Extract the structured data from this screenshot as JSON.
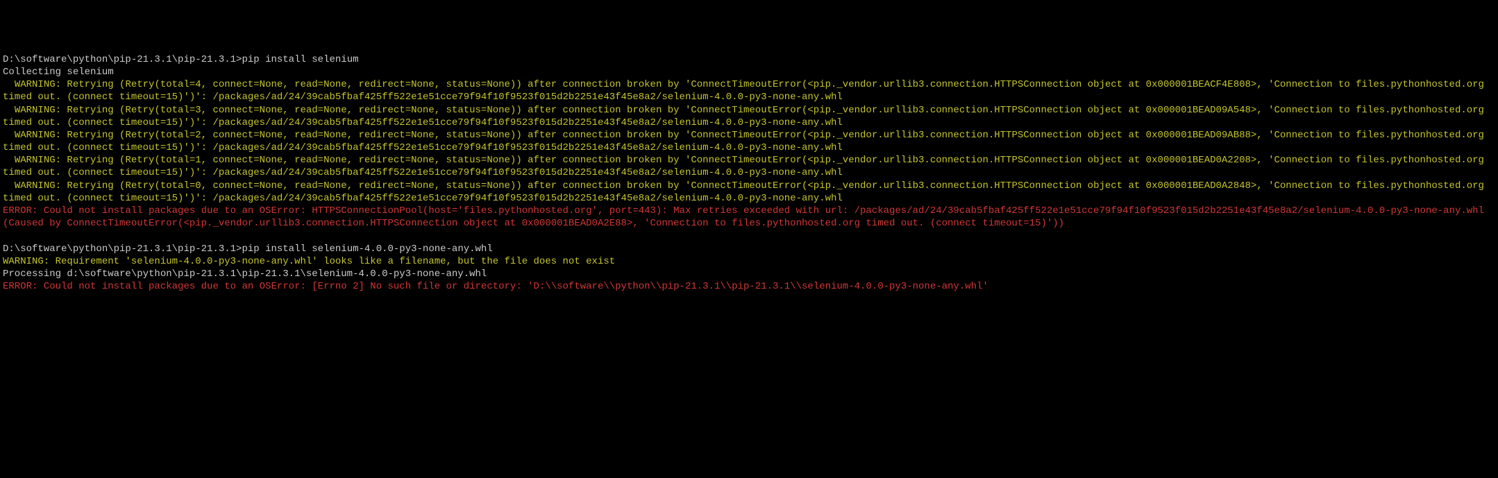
{
  "terminal": {
    "prompt1": {
      "path": "D:\\software\\python\\pip-21.3.1\\pip-21.3.1>",
      "command": "pip install selenium"
    },
    "collecting": "Collecting selenium",
    "warning1": "  WARNING: Retrying (Retry(total=4, connect=None, read=None, redirect=None, status=None)) after connection broken by 'ConnectTimeoutError(<pip._vendor.urllib3.connection.HTTPSConnection object at 0x000001BEACF4E808>, 'Connection to files.pythonhosted.org timed out. (connect timeout=15)')': /packages/ad/24/39cab5fbaf425ff522e1e51cce79f94f10f9523f015d2b2251e43f45e8a2/selenium-4.0.0-py3-none-any.whl",
    "warning2": "  WARNING: Retrying (Retry(total=3, connect=None, read=None, redirect=None, status=None)) after connection broken by 'ConnectTimeoutError(<pip._vendor.urllib3.connection.HTTPSConnection object at 0x000001BEAD09A548>, 'Connection to files.pythonhosted.org timed out. (connect timeout=15)')': /packages/ad/24/39cab5fbaf425ff522e1e51cce79f94f10f9523f015d2b2251e43f45e8a2/selenium-4.0.0-py3-none-any.whl",
    "warning3": "  WARNING: Retrying (Retry(total=2, connect=None, read=None, redirect=None, status=None)) after connection broken by 'ConnectTimeoutError(<pip._vendor.urllib3.connection.HTTPSConnection object at 0x000001BEAD09AB88>, 'Connection to files.pythonhosted.org timed out. (connect timeout=15)')': /packages/ad/24/39cab5fbaf425ff522e1e51cce79f94f10f9523f015d2b2251e43f45e8a2/selenium-4.0.0-py3-none-any.whl",
    "warning4": "  WARNING: Retrying (Retry(total=1, connect=None, read=None, redirect=None, status=None)) after connection broken by 'ConnectTimeoutError(<pip._vendor.urllib3.connection.HTTPSConnection object at 0x000001BEAD0A2208>, 'Connection to files.pythonhosted.org timed out. (connect timeout=15)')': /packages/ad/24/39cab5fbaf425ff522e1e51cce79f94f10f9523f015d2b2251e43f45e8a2/selenium-4.0.0-py3-none-any.whl",
    "warning5": "  WARNING: Retrying (Retry(total=0, connect=None, read=None, redirect=None, status=None)) after connection broken by 'ConnectTimeoutError(<pip._vendor.urllib3.connection.HTTPSConnection object at 0x000001BEAD0A2848>, 'Connection to files.pythonhosted.org timed out. (connect timeout=15)')': /packages/ad/24/39cab5fbaf425ff522e1e51cce79f94f10f9523f015d2b2251e43f45e8a2/selenium-4.0.0-py3-none-any.whl",
    "error1": "ERROR: Could not install packages due to an OSError: HTTPSConnectionPool(host='files.pythonhosted.org', port=443): Max retries exceeded with url: /packages/ad/24/39cab5fbaf425ff522e1e51cce79f94f10f9523f015d2b2251e43f45e8a2/selenium-4.0.0-py3-none-any.whl (Caused by ConnectTimeoutError(<pip._vendor.urllib3.connection.HTTPSConnection object at 0x000001BEAD0A2E88>, 'Connection to files.pythonhosted.org timed out. (connect timeout=15)'))",
    "blank": "",
    "prompt2": {
      "path": "D:\\software\\python\\pip-21.3.1\\pip-21.3.1>",
      "command": "pip install selenium-4.0.0-py3-none-any.whl"
    },
    "warning6": "WARNING: Requirement 'selenium-4.0.0-py3-none-any.whl' looks like a filename, but the file does not exist",
    "processing": "Processing d:\\software\\python\\pip-21.3.1\\pip-21.3.1\\selenium-4.0.0-py3-none-any.whl",
    "error2": "ERROR: Could not install packages due to an OSError: [Errno 2] No such file or directory: 'D:\\\\software\\\\python\\\\pip-21.3.1\\\\pip-21.3.1\\\\selenium-4.0.0-py3-none-any.whl'"
  }
}
